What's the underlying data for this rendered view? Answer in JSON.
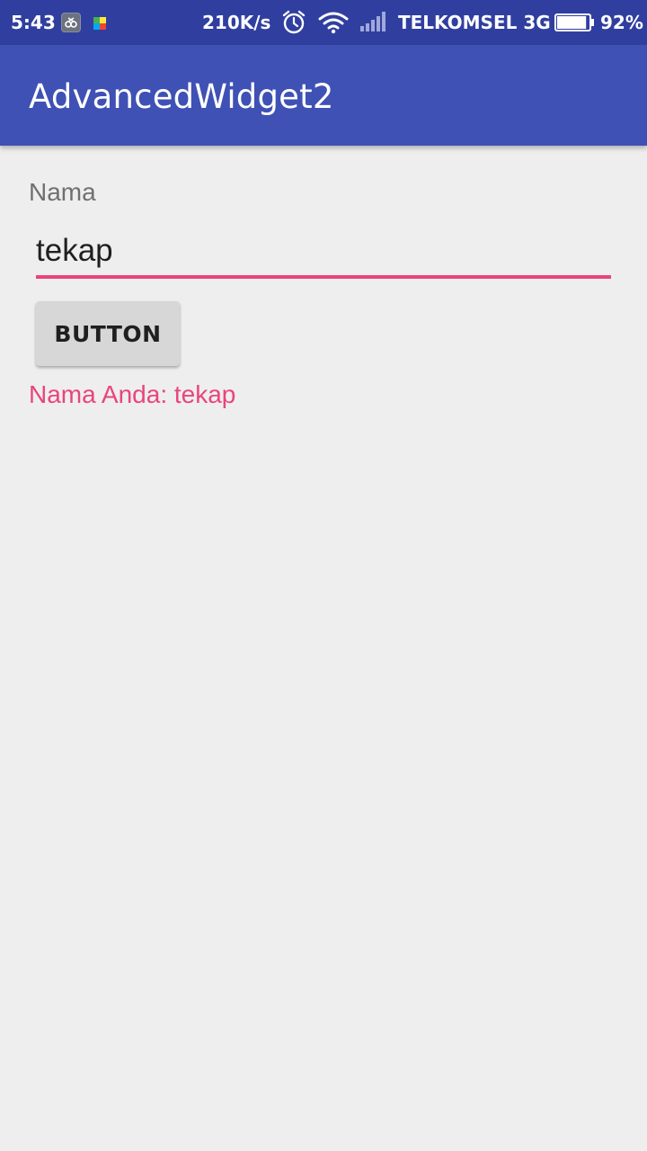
{
  "status_bar": {
    "time": "5:43",
    "network_speed": "210K/s",
    "carrier": "TELKOMSEL 3G",
    "battery_percent": "92%",
    "battery_level": 0.92,
    "icons": [
      "notification-app-icon",
      "colorful-app-icon",
      "alarm-icon",
      "wifi-icon",
      "signal-icon",
      "battery-icon"
    ]
  },
  "app_bar": {
    "title": "AdvancedWidget2",
    "color": "#3f51b5",
    "status_color": "#303f9f"
  },
  "form": {
    "label": "Nama",
    "input_value": "tekap",
    "button_label": "BUTTON",
    "result_text": "Nama Anda: tekap",
    "accent_color": "#e9457d"
  }
}
